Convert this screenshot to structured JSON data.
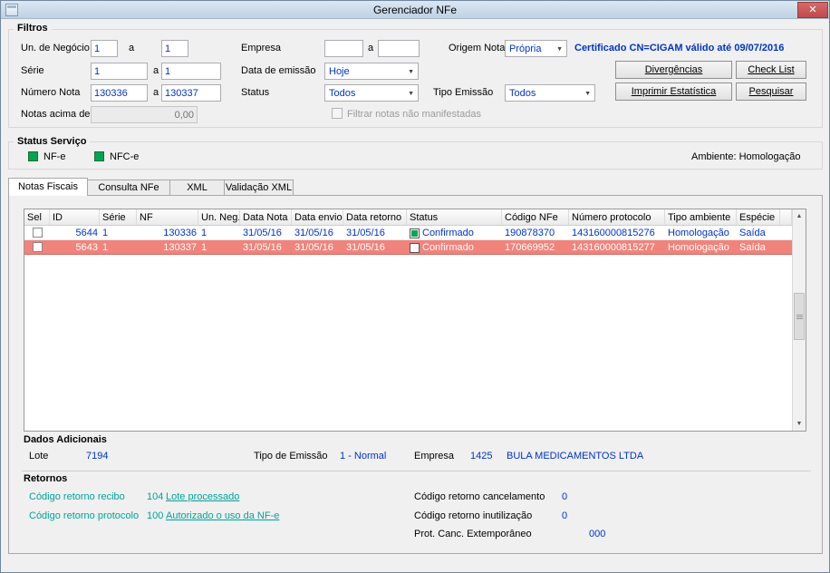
{
  "window": {
    "title": "Gerenciador NFe"
  },
  "icons": {
    "close": "✕",
    "chevron_down": "▼",
    "arrow_up": "▲",
    "arrow_down": "▼"
  },
  "colors": {
    "value_blue": "#0033cc",
    "link_teal": "#00a39a",
    "selected_row_red": "#f0837c",
    "status_green": "#00a651",
    "close_button_red": "#c14a4a",
    "titlebar_blue": "#c6d8ea"
  },
  "filters": {
    "group_label": "Filtros",
    "range_separator": "a",
    "un_negocio": {
      "label": "Un. de Negócio",
      "from": "1",
      "to": "1"
    },
    "empresa": {
      "label": "Empresa",
      "from": "",
      "to": ""
    },
    "origem_nota": {
      "label": "Origem Nota",
      "value": "Própria"
    },
    "certificado": "Certificado CN=CIGAM válido até 09/07/2016",
    "serie": {
      "label": "Série",
      "from": "1",
      "to": "1"
    },
    "data_emissao": {
      "label": "Data de emissão",
      "value": "Hoje"
    },
    "numero_nota": {
      "label": "Número Nota",
      "from": "130336",
      "to": "130337"
    },
    "status": {
      "label": "Status",
      "value": "Todos"
    },
    "tipo_emissao": {
      "label": "Tipo Emissão",
      "value": "Todos"
    },
    "notas_acima": {
      "label": "Notas acima de",
      "value": "0,00",
      "enabled": false
    },
    "filtrar_manifestadas": {
      "label": "Filtrar notas não manifestadas",
      "checked": false,
      "enabled": false
    },
    "buttons": {
      "divergencias": "Divergências",
      "check_list": "Check List",
      "imprimir_estatistica": "Imprimir Estatística",
      "pesquisar": "Pesquisar"
    }
  },
  "status_servico": {
    "group_label": "Status Serviço",
    "nfe_label": "NF-e",
    "nfce_label": "NFC-e",
    "ambiente": "Ambiente: Homologação"
  },
  "tabs": [
    {
      "label": "Notas Fiscais",
      "active": true
    },
    {
      "label": "Consulta NFe",
      "active": false
    },
    {
      "label": "XML",
      "active": false
    },
    {
      "label": "Validação XML",
      "active": false
    }
  ],
  "grid": {
    "columns": [
      "Sel",
      "ID",
      "Série",
      "NF",
      "Un. Neg.",
      "Data Nota",
      "Data envio",
      "Data retorno",
      "Status",
      "Código NFe",
      "Número protocolo",
      "Tipo ambiente",
      "Espécie"
    ],
    "rows": [
      {
        "selected": false,
        "id": "5644",
        "serie": "1",
        "nf": "130336",
        "un_neg": "1",
        "data_nota": "31/05/16",
        "data_envio": "31/05/16",
        "data_retorno": "31/05/16",
        "status": "Confirmado",
        "codigo_nfe": "190878370",
        "numero_protocolo": "143160000815276",
        "tipo_ambiente": "Homologação",
        "especie": "Saída"
      },
      {
        "selected": true,
        "id": "5643",
        "serie": "1",
        "nf": "130337",
        "un_neg": "1",
        "data_nota": "31/05/16",
        "data_envio": "31/05/16",
        "data_retorno": "31/05/16",
        "status": "Confirmado",
        "codigo_nfe": "170669952",
        "numero_protocolo": "143160000815277",
        "tipo_ambiente": "Homologação",
        "especie": "Saída"
      }
    ]
  },
  "dados_adicionais": {
    "group_label": "Dados Adicionais",
    "lote_label": "Lote",
    "lote_value": "7194",
    "tipo_emissao_label": "Tipo de Emissão",
    "tipo_emissao_value": "1 - Normal",
    "empresa_label": "Empresa",
    "empresa_codigo": "1425",
    "empresa_nome": "BULA MEDICAMENTOS LTDA"
  },
  "retornos": {
    "group_label": "Retornos",
    "recibo_label": "Código retorno recibo",
    "recibo_codigo": "104",
    "recibo_link": "Lote processado",
    "protocolo_label": "Código retorno protocolo",
    "protocolo_codigo": "100",
    "protocolo_link": "Autorizado o uso da NF-e",
    "cancelamento_label": "Código retorno cancelamento",
    "cancelamento_valor": "0",
    "inutilizacao_label": "Código retorno inutilização",
    "inutilizacao_valor": "0",
    "extemporaneo_label": "Prot. Canc. Extemporâneo",
    "extemporaneo_valor": "000"
  }
}
